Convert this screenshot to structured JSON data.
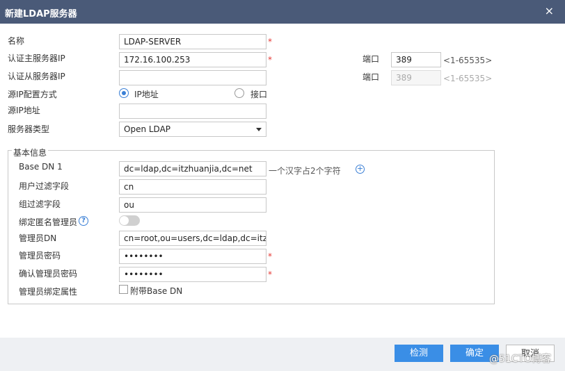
{
  "dialog": {
    "title": "新建LDAP服务器",
    "close_icon": "×"
  },
  "form": {
    "name_label": "名称",
    "name_value": "LDAP-SERVER",
    "primary_ip_label": "认证主服务器IP",
    "primary_ip_value": "172.16.100.253",
    "secondary_ip_label": "认证从服务器IP",
    "secondary_ip_value": "",
    "port_label": "端口",
    "port_primary": "389",
    "port_secondary": "389",
    "port_range": "<1-65535>",
    "source_ip_mode_label": "源IP配置方式",
    "source_ip_mode_options": [
      "IP地址",
      "接口"
    ],
    "source_ip_label": "源IP地址",
    "source_ip_value": "",
    "server_type_label": "服务器类型",
    "server_type_value": "Open LDAP",
    "required_mark": "*"
  },
  "basic_info": {
    "legend": "基本信息",
    "base_dn_label": "Base DN 1",
    "base_dn_value": "dc=ldap,dc=itzhuanjia,dc=net",
    "base_dn_hint": "一个汉字占2个字符",
    "user_filter_label": "用户过滤字段",
    "user_filter_value": "cn",
    "group_filter_label": "组过滤字段",
    "group_filter_value": "ou",
    "anonymous_admin_label": "绑定匿名管理员",
    "admin_dn_label": "管理员DN",
    "admin_dn_value": "cn=root,ou=users,dc=ldap,dc=itzhuanjia,dc=net",
    "admin_password_label": "管理员密码",
    "admin_password_value": "••••••••",
    "confirm_password_label": "确认管理员密码",
    "confirm_password_value": "••••••••",
    "admin_bind_attr_label": "管理员绑定属性",
    "append_base_dn_label": "附带Base DN"
  },
  "buttons": {
    "detect": "检测",
    "ok": "确定",
    "cancel": "取消"
  },
  "watermark": "@51CTO博客",
  "colors": {
    "titlebar": "#4a5a78",
    "primary": "#3a8ee6",
    "required": "#e53935"
  }
}
